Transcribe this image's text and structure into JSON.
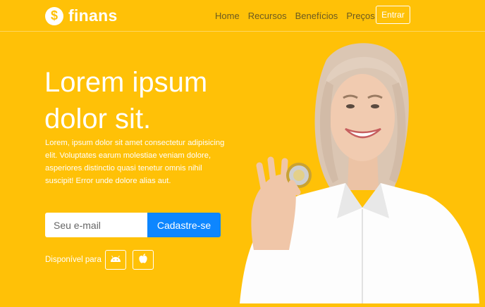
{
  "brand": {
    "icon_glyph": "$",
    "name": "finans",
    "icon": "dollar-coin-icon"
  },
  "nav": {
    "links": [
      "Home",
      "Recursos",
      "Benefícios",
      "Preços"
    ],
    "login_label": "Entrar"
  },
  "hero": {
    "title_line1": "Lorem ipsum",
    "title_line2": "dolor sit.",
    "text": "Lorem, ipsum dolor sit amet consectetur adipisicing elit. Voluptates earum molestiae veniam dolore, asperiores distinctio quasi tenetur omnis nihil suscipit! Error unde dolore alias aut."
  },
  "signup": {
    "placeholder": "Seu e-mail",
    "value": "",
    "button_label": "Cadastre-se"
  },
  "availability": {
    "label": "Disponível para",
    "stores": [
      "android-icon",
      "apple-icon"
    ]
  },
  "colors": {
    "background": "#ffc107",
    "button": "#0d86ff",
    "nav_link": "#6b5a21",
    "text": "#ffffff"
  }
}
